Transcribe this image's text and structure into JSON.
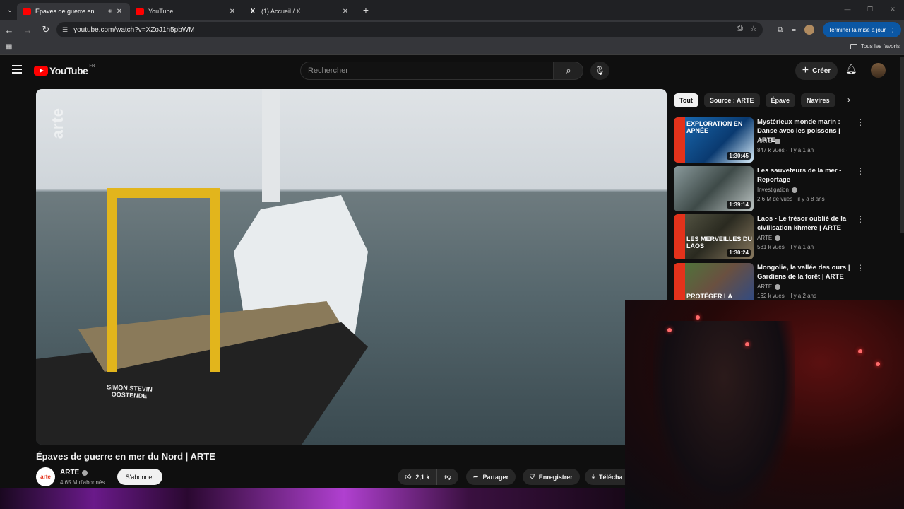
{
  "browser": {
    "tabs": [
      {
        "title": "Épaves de guerre en mer du Nord | ARTE",
        "favicon": "youtube-icon",
        "active": true,
        "audio": true
      },
      {
        "title": "YouTube",
        "favicon": "youtube-icon",
        "active": false
      },
      {
        "title": "(1) Accueil / X",
        "favicon": "x-icon",
        "active": false
      }
    ],
    "url": "youtube.com/watch?v=XZoJ1h5pbWM",
    "update_label": "Terminer la mise à jour",
    "bookmarks_label": "Tous les favoris"
  },
  "youtube": {
    "logo": "YouTube",
    "country": "FR",
    "search_placeholder": "Rechercher",
    "create_label": "Créer"
  },
  "video": {
    "title": "Épaves de guerre en mer du Nord | ARTE",
    "watermark": "arte",
    "ship_name": "SIMON STEVIN",
    "ship_port": "OOSTENDE",
    "channel": "ARTE",
    "channel_avatar": "arte",
    "subscribers": "4,65 M d'abonnés",
    "subscribe_label": "S'abonner",
    "likes": "2,1 k",
    "share_label": "Partager",
    "save_label": "Enregistrer",
    "download_label": "Télécha"
  },
  "chips": [
    "Tout",
    "Source : ARTE",
    "Épave",
    "Navires"
  ],
  "recommendations": [
    {
      "title": "Mystérieux monde marin : Danse avec les poissons | ARTE",
      "channel": "ARTE",
      "meta": "847 k vues · il y a 1 an",
      "duration": "1:30:45",
      "thumb_text": "EXPLORATION EN APNÉE"
    },
    {
      "title": "Les sauveteurs de la mer - Reportage",
      "channel": "Investigation",
      "meta": "2,6 M de vues · il y a 8 ans",
      "duration": "1:39:14",
      "thumb_text": ""
    },
    {
      "title": "Laos - Le trésor oublié de la civilisation khmère | ARTE",
      "channel": "ARTE",
      "meta": "531 k vues · il y a 1 an",
      "duration": "1:30:24",
      "thumb_text": "LES MERVEILLES DU LAOS"
    },
    {
      "title": "Mongolie, la vallée des ours | Gardiens de la forêt | ARTE",
      "channel": "ARTE",
      "meta": "162 k vues · il y a 2 ans",
      "duration": "",
      "thumb_text": "PROTÉGER LA"
    }
  ],
  "colors": {
    "youtube_red": "#ff0000",
    "arte_red": "#e3321b",
    "update_blue": "#0b57a4"
  }
}
